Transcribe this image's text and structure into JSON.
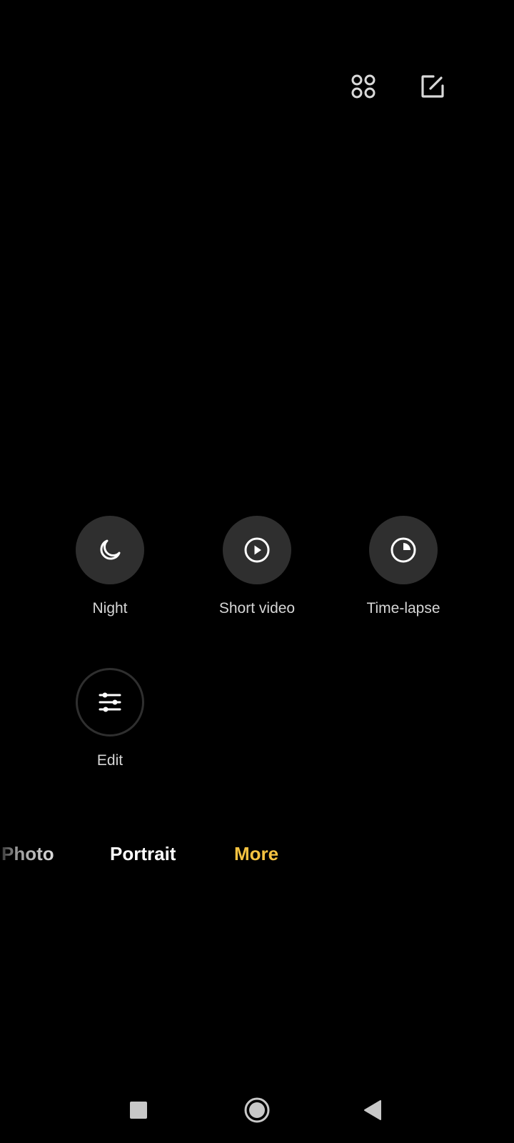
{
  "top_bar": {
    "icons": [
      "apps-grid-icon",
      "edit-square-icon"
    ]
  },
  "modes": [
    {
      "label": "Night",
      "icon": "moon-icon"
    },
    {
      "label": "Short video",
      "icon": "play-circle-icon"
    },
    {
      "label": "Time-lapse",
      "icon": "timer-icon"
    },
    {
      "label": "Edit",
      "icon": "sliders-icon"
    }
  ],
  "tabs": {
    "photo": "Photo",
    "portrait": "Portrait",
    "more": "More",
    "active": "More",
    "active_color": "#f5c341"
  },
  "nav_bar": {
    "icons": [
      "recents-square-icon",
      "home-circle-icon",
      "back-triangle-icon"
    ]
  }
}
